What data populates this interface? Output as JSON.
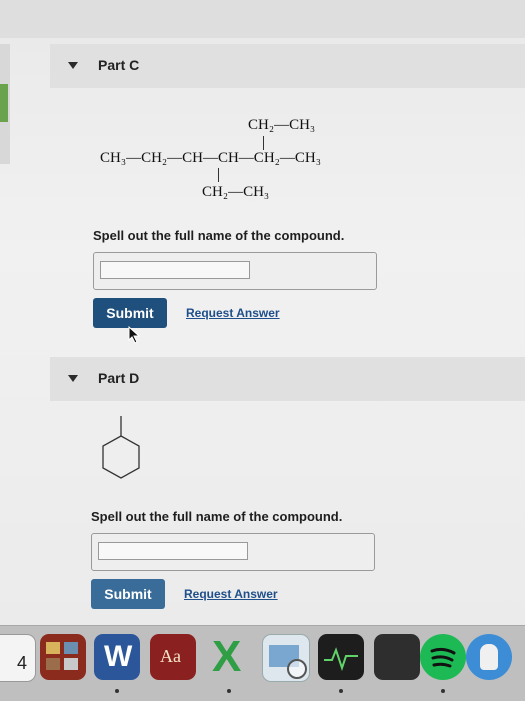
{
  "part_c": {
    "title": "Part C",
    "structure": {
      "top_branch": "CH₂—CH₃",
      "main_chain": "CH₃—CH₂—CH—CH—CH₂—CH₃",
      "bottom_branch": "CH₂—CH₃"
    },
    "prompt": "Spell out the full name of the compound.",
    "answer_value": "",
    "submit_label": "Submit",
    "request_label": "Request Answer"
  },
  "part_d": {
    "title": "Part D",
    "prompt": "Spell out the full name of the compound.",
    "answer_value": "",
    "submit_label": "Submit",
    "request_label": "Request Answer"
  },
  "dock": {
    "items": [
      {
        "icon": "calendar-icon",
        "label": "4"
      },
      {
        "icon": "photo-booth-icon"
      },
      {
        "icon": "word-icon",
        "label": "W"
      },
      {
        "icon": "dictionary-icon",
        "label": "Aa"
      },
      {
        "icon": "excel-icon",
        "label": "X"
      },
      {
        "icon": "preview-icon"
      },
      {
        "icon": "activity-monitor-icon"
      },
      {
        "icon": "app-dark-icon"
      },
      {
        "icon": "spotify-icon"
      },
      {
        "icon": "finder-blue-icon"
      }
    ]
  },
  "colors": {
    "button": "#1f4f7c",
    "link": "#1f4f8a",
    "header": "#e0e0e0"
  }
}
